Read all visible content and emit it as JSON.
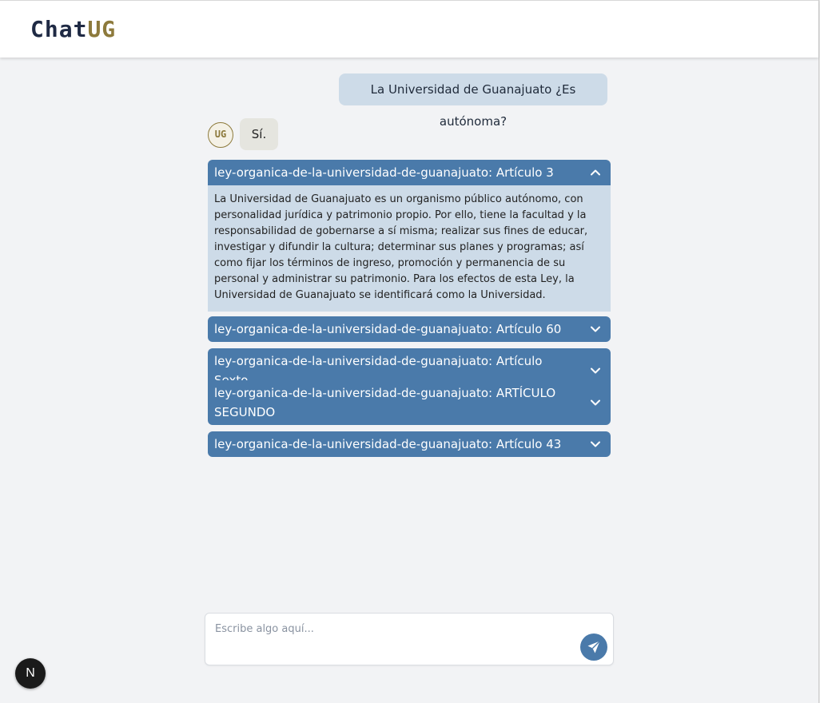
{
  "header": {
    "logo_chat": "Chat",
    "logo_ug": "UG"
  },
  "conversation": {
    "user_message": "La Universidad de Guanajuato ¿Es autónoma?",
    "bot_avatar": "UG",
    "bot_message": "Sí."
  },
  "sources": [
    {
      "title": "ley-organica-de-la-universidad-de-guanajuato: Artículo 3",
      "expanded": true,
      "content": "La Universidad de Guanajuato es un organismo público autónomo, con personalidad jurídica y patrimonio propio. Por ello, tiene la facultad y la responsabilidad de gobernarse a sí misma; realizar sus fines de educar, investigar y difundir la cultura; determinar sus planes y programas; así como fijar los términos de ingreso, promoción y permanencia de su personal y administrar su patrimonio. Para los efectos de esta Ley, la Universidad de Guanajuato se identificará como la Universidad."
    },
    {
      "title": "ley-organica-de-la-universidad-de-guanajuato: Artículo 60",
      "expanded": false
    },
    {
      "title": "ley-organica-de-la-universidad-de-guanajuato: Artículo Sexto",
      "expanded": false
    },
    {
      "title": "ley-organica-de-la-universidad-de-guanajuato: ARTÍCULO SEGUNDO",
      "expanded": false
    },
    {
      "title": "ley-organica-de-la-universidad-de-guanajuato: Artículo 43",
      "expanded": false
    }
  ],
  "input": {
    "placeholder": "Escribe algo aquí..."
  },
  "icons": {
    "send": "paper-plane-icon",
    "expanded": "chevron-up-icon",
    "collapsed": "chevron-down-icon"
  },
  "dev_badge": "N",
  "colors": {
    "accent": "#4a7aaa",
    "user_bubble": "#cddbe8",
    "bot_bubble": "#e5e5df",
    "logo_gold": "#8d7a3c",
    "logo_navy": "#1f2a44"
  }
}
